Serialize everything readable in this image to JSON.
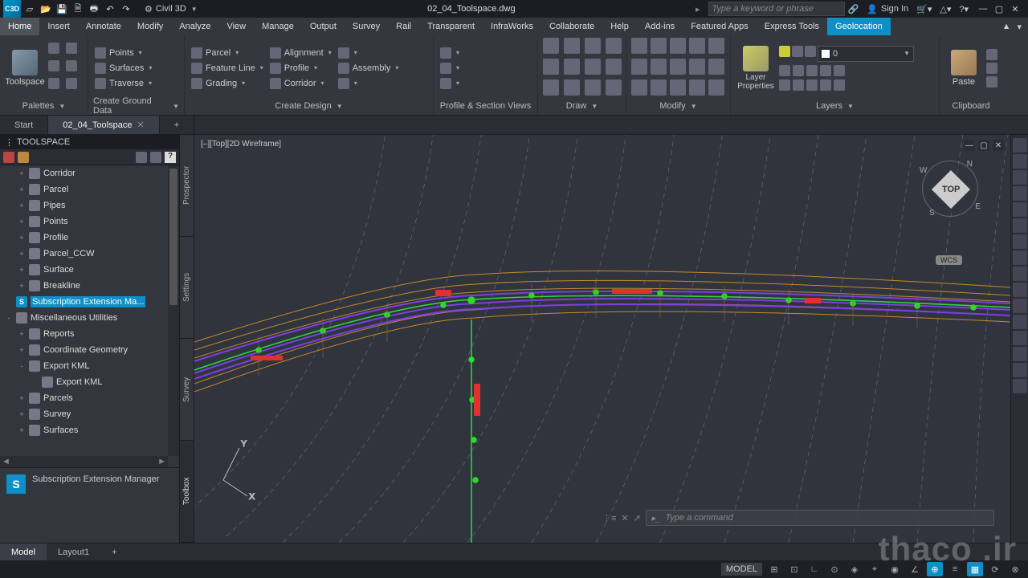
{
  "app": {
    "workspace": "Civil 3D",
    "file": "02_04_Toolspace.dwg",
    "search_ph": "Type a keyword or phrase",
    "signin": "Sign In"
  },
  "menu": {
    "tabs": [
      "Home",
      "Insert",
      "Annotate",
      "Modify",
      "Analyze",
      "View",
      "Manage",
      "Output",
      "Survey",
      "Rail",
      "Transparent",
      "InfraWorks",
      "Collaborate",
      "Help",
      "Add-ins",
      "Featured Apps",
      "Express Tools",
      "Geolocation"
    ],
    "active": 0
  },
  "ribbon": {
    "palettes": {
      "big": "Toolspace",
      "title": "Palettes"
    },
    "ground": {
      "rows": [
        "Points",
        "Surfaces",
        "Traverse"
      ],
      "title": "Create Ground Data"
    },
    "design": {
      "col1": [
        "Parcel",
        "Feature Line",
        "Grading"
      ],
      "col2": [
        "Alignment",
        "Profile",
        "Corridor"
      ],
      "col3": [
        "",
        "Assembly",
        ""
      ],
      "title": "Create Design"
    },
    "psv": {
      "title": "Profile & Section Views"
    },
    "draw": {
      "title": "Draw"
    },
    "modify": {
      "title": "Modify"
    },
    "layers": {
      "big": "Layer Properties",
      "combo_val": "0",
      "title": "Layers"
    },
    "clip": {
      "big": "Paste",
      "title": "Clipboard"
    }
  },
  "doctabs": {
    "items": [
      "Start",
      "02_04_Toolspace"
    ],
    "active": 1
  },
  "toolspace": {
    "title": "TOOLSPACE",
    "side_tabs": [
      "Prospector",
      "Settings",
      "Survey",
      "Toolbox"
    ],
    "side_active": 3,
    "tree": [
      {
        "exp": "+",
        "ico": "doc",
        "label": "Corridor",
        "indent": 1
      },
      {
        "exp": "+",
        "ico": "doc",
        "label": "Parcel",
        "indent": 1
      },
      {
        "exp": "+",
        "ico": "doc",
        "label": "Pipes",
        "indent": 1
      },
      {
        "exp": "+",
        "ico": "doc",
        "label": "Points",
        "indent": 1
      },
      {
        "exp": "+",
        "ico": "doc",
        "label": "Profile",
        "indent": 1
      },
      {
        "exp": "+",
        "ico": "doc",
        "label": "Parcel_CCW",
        "indent": 1
      },
      {
        "exp": "+",
        "ico": "doc",
        "label": "Surface",
        "indent": 1
      },
      {
        "exp": "+",
        "ico": "doc",
        "label": "Breakline",
        "indent": 1
      },
      {
        "exp": "",
        "ico": "S",
        "label": "Subscription Extension Ma...",
        "indent": 0,
        "selected": true
      },
      {
        "exp": "-",
        "ico": "box",
        "label": "Miscellaneous Utilities",
        "indent": 0
      },
      {
        "exp": "+",
        "ico": "rep",
        "label": "Reports",
        "indent": 1
      },
      {
        "exp": "+",
        "ico": "geo",
        "label": "Coordinate Geometry",
        "indent": 1
      },
      {
        "exp": "-",
        "ico": "kml",
        "label": "Export KML",
        "indent": 1
      },
      {
        "exp": "",
        "ico": "kml",
        "label": "Export KML",
        "indent": 2
      },
      {
        "exp": "+",
        "ico": "par",
        "label": "Parcels",
        "indent": 1
      },
      {
        "exp": "+",
        "ico": "sur",
        "label": "Survey",
        "indent": 1
      },
      {
        "exp": "+",
        "ico": "srf",
        "label": "Surfaces",
        "indent": 1
      }
    ],
    "detail": "Subscription Extension Manager"
  },
  "viewport": {
    "label": "[–][Top][2D Wireframe]",
    "viewcube_face": "TOP",
    "wcs": "WCS",
    "dirs": {
      "n": "N",
      "s": "S",
      "e": "E",
      "w": "W"
    }
  },
  "cmd": {
    "placeholder": "Type a command"
  },
  "layout": {
    "tabs": [
      "Model",
      "Layout1"
    ],
    "active": 0
  },
  "status": {
    "model": "MODEL"
  },
  "watermark": "thaco .ir"
}
